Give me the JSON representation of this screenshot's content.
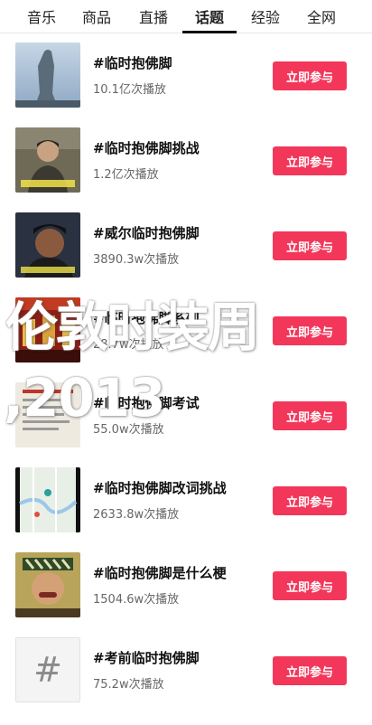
{
  "tabs": [
    "音乐",
    "商品",
    "直播",
    "话题",
    "经验",
    "全网"
  ],
  "active_tab": "话题",
  "button_label": "立即参与",
  "items": [
    {
      "title": "#临时抱佛脚",
      "count": "10.1亿次播放",
      "thumb": "statue"
    },
    {
      "title": "#临时抱佛脚挑战",
      "count": "1.2亿次播放",
      "thumb": "person-class"
    },
    {
      "title": "#威尔临时抱佛脚",
      "count": "3890.3w次播放",
      "thumb": "person-dark"
    },
    {
      "title": "#临时抱佛脚系列",
      "count": "28.7w次播放",
      "thumb": "red-scene"
    },
    {
      "title": "#临时抱佛脚考试",
      "count": "55.0w次播放",
      "thumb": "paper"
    },
    {
      "title": "#临时抱佛脚改词挑战",
      "count": "2633.8w次播放",
      "thumb": "map"
    },
    {
      "title": "#临时抱佛脚是什么梗",
      "count": "1504.6w次播放",
      "thumb": "person-yellow"
    },
    {
      "title": "#考前临时抱佛脚",
      "count": "75.2w次播放",
      "thumb": "hash"
    }
  ],
  "overlay": {
    "line1": "伦敦时装周",
    "line2": ",2013"
  },
  "colors": {
    "button": "#f2375a"
  }
}
